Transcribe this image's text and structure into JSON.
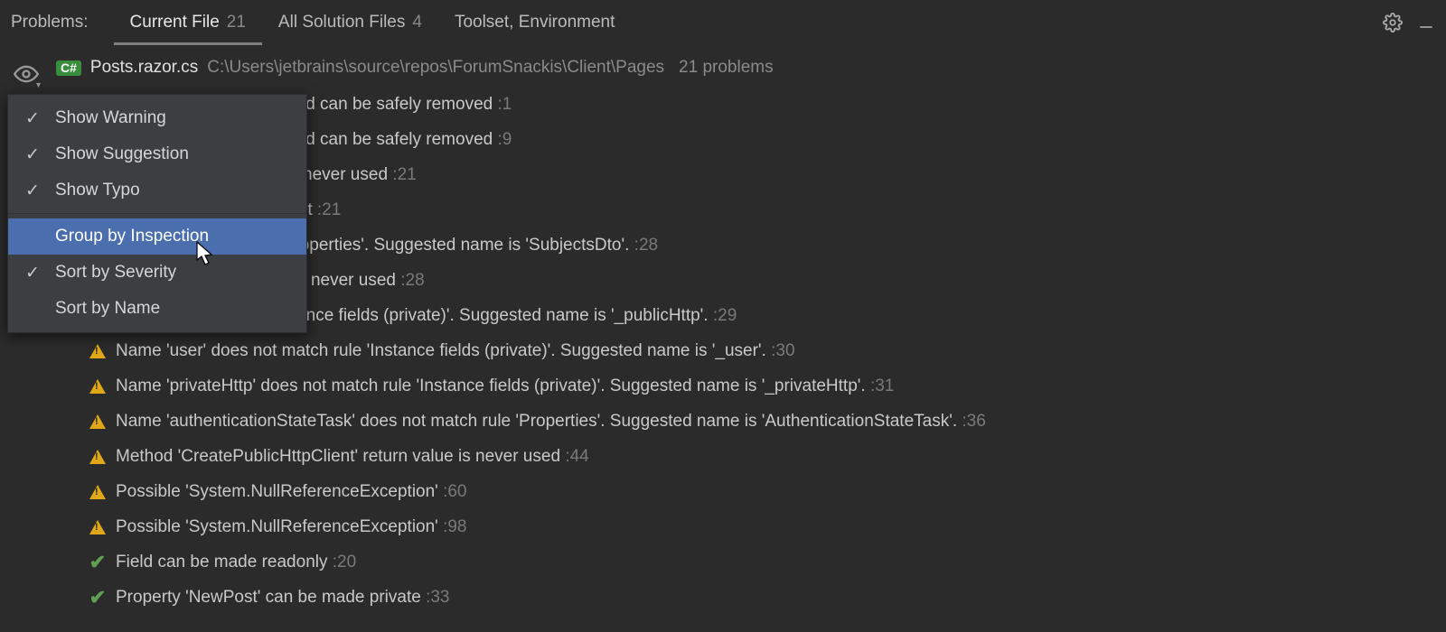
{
  "toolbar": {
    "label": "Problems:",
    "tabs": [
      {
        "label": "Current File",
        "count": "21",
        "active": true
      },
      {
        "label": "All Solution Files",
        "count": "4",
        "active": false
      },
      {
        "label": "Toolset, Environment",
        "count": "",
        "active": false
      }
    ]
  },
  "file": {
    "lang_badge": "C#",
    "name": "Posts.razor.cs",
    "path": "C:\\Users\\jetbrains\\source\\repos\\ForumSnackis\\Client\\Pages",
    "problem_count": "21 problems"
  },
  "rows": [
    {
      "icon": "warn",
      "msg": "t required by the code and can be safely removed",
      "loc": ":1"
    },
    {
      "icon": "warn",
      "msg": "t required by the code and can be safely removed",
      "loc": ":9"
    },
    {
      "icon": "warn",
      "msg": "assigned but its value is never used",
      "loc": ":21"
    },
    {
      "icon": "warn",
      "msg": "default value is redundant",
      "loc": ":21"
    },
    {
      "icon": "warn",
      "msg": "' does not match rule 'Properties'. Suggested name is 'SubjectsDto'.",
      "loc": ":28"
    },
    {
      "icon": "warn",
      "msg": "ssor 'SubjectsDTO.set' is never used",
      "loc": ":28"
    },
    {
      "icon": "warn",
      "msg": "loes not match rule 'Instance fields (private)'. Suggested name is '_publicHttp'.",
      "loc": ":29"
    },
    {
      "icon": "warn",
      "msg": "Name 'user' does not match rule 'Instance fields (private)'. Suggested name is '_user'.",
      "loc": ":30"
    },
    {
      "icon": "warn",
      "msg": "Name 'privateHttp' does not match rule 'Instance fields (private)'. Suggested name is '_privateHttp'.",
      "loc": ":31"
    },
    {
      "icon": "warn",
      "msg": "Name 'authenticationStateTask' does not match rule 'Properties'. Suggested name is 'AuthenticationStateTask'.",
      "loc": ":36"
    },
    {
      "icon": "warn",
      "msg": "Method 'CreatePublicHttpClient' return value is never used",
      "loc": ":44"
    },
    {
      "icon": "warn",
      "msg": "Possible 'System.NullReferenceException'",
      "loc": ":60"
    },
    {
      "icon": "warn",
      "msg": "Possible 'System.NullReferenceException'",
      "loc": ":98"
    },
    {
      "icon": "ok",
      "msg": "Field can be made readonly",
      "loc": ":20"
    },
    {
      "icon": "ok",
      "msg": "Property 'NewPost' can be made private",
      "loc": ":33"
    }
  ],
  "menu": {
    "items_top": [
      {
        "label": "Show Warning",
        "checked": true
      },
      {
        "label": "Show Suggestion",
        "checked": true
      },
      {
        "label": "Show Typo",
        "checked": true
      }
    ],
    "items_bottom": [
      {
        "label": "Group by Inspection",
        "checked": false,
        "selected": true
      },
      {
        "label": "Sort by Severity",
        "checked": true
      },
      {
        "label": "Sort by Name",
        "checked": false
      }
    ]
  }
}
